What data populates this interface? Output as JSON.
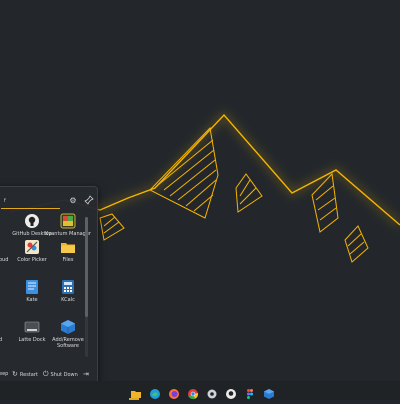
{
  "colors": {
    "accent": "#f5b400",
    "background": "#23272b",
    "panel": "#26292e"
  },
  "launcher": {
    "search_text": "f",
    "config_icon": "gear-icon",
    "pin_icon": "pin-icon",
    "partial_labels": {
      "row2": "oud",
      "row4": "d"
    },
    "apps": [
      {
        "label": "GitHub Desktop",
        "icon": "github-icon"
      },
      {
        "label": "Kvantum Manager",
        "icon": "kvantum-icon"
      },
      {
        "label": "Color Picker",
        "icon": "color-picker-icon"
      },
      {
        "label": "Files",
        "icon": "folder-icon"
      },
      {
        "label": "Kate",
        "icon": "kate-icon"
      },
      {
        "label": "KCalc",
        "icon": "calculator-icon"
      },
      {
        "label": "Latte Dock",
        "icon": "dock-icon"
      },
      {
        "label": "Add/Remove Software",
        "icon": "package-icon"
      }
    ],
    "footer": {
      "sleep": "eep",
      "restart": "Restart",
      "shutdown": "Shut Down"
    }
  },
  "taskbar": {
    "icons": [
      "files-icon",
      "edge-icon",
      "firefox-icon",
      "chrome-icon",
      "settings-icon",
      "github-icon",
      "figma-icon",
      "package-icon"
    ]
  }
}
